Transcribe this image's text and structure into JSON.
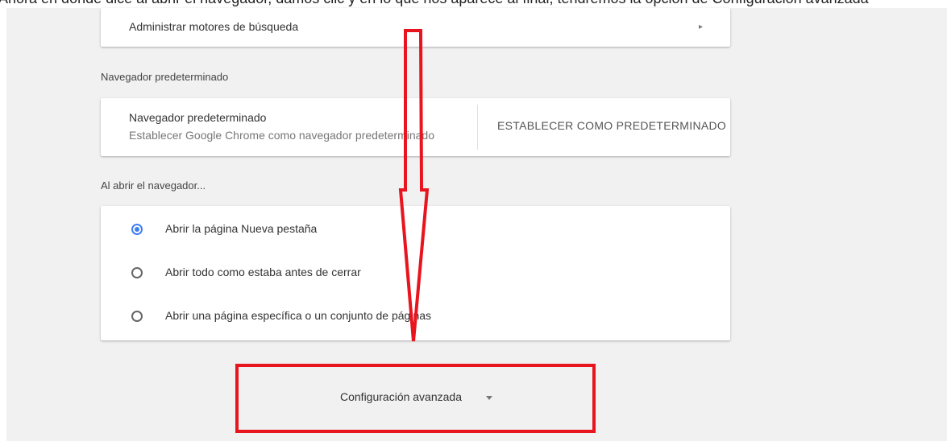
{
  "top_partial_text": "Ahora en donde dice al abrir el navegador, damos clic y en lo que nos aparece al final, tendremos la opción de Configuración avanzada",
  "search_engines": {
    "label": "Administrar motores de búsqueda",
    "chevron": "chevron-right-icon"
  },
  "default_browser": {
    "section_title": "Navegador predeterminado",
    "primary": "Navegador predeterminado",
    "secondary": "Establecer Google Chrome como navegador predeterminado",
    "button_label": "ESTABLECER COMO PREDETERMINADO"
  },
  "on_startup": {
    "section_title": "Al abrir el navegador...",
    "options": [
      {
        "label": "Abrir la página Nueva pestaña",
        "checked": true
      },
      {
        "label": "Abrir todo como estaba antes de cerrar",
        "checked": false
      },
      {
        "label": "Abrir una página específica o un conjunto de páginas",
        "checked": false
      }
    ]
  },
  "advanced": {
    "label": "Configuración avanzada",
    "icon": "caret-down-icon"
  },
  "colors": {
    "accent": "#3f7ef2",
    "annotation": "#e8141e",
    "background": "#f1f1f1"
  }
}
